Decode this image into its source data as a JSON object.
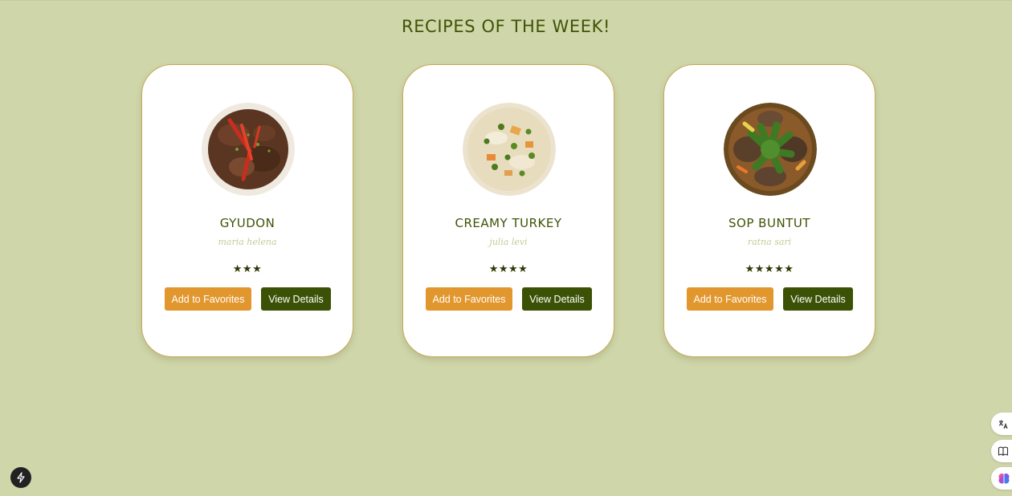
{
  "page": {
    "title": "RECIPES OF THE WEEK!"
  },
  "recipes": [
    {
      "name": "GYUDON",
      "author": "maria helena",
      "rating": 3,
      "stars": "★★★",
      "image": "gyudon-photo",
      "favorite_label": "Add to Favorites",
      "details_label": "View Details"
    },
    {
      "name": "CREAMY TURKEY",
      "author": "julia levi",
      "rating": 4,
      "stars": "★★★★",
      "image": "creamy-turkey-photo",
      "favorite_label": "Add to Favorites",
      "details_label": "View Details"
    },
    {
      "name": "SOP BUNTUT",
      "author": "ratna sari",
      "rating": 5,
      "stars": "★★★★★",
      "image": "sop-buntut-photo",
      "favorite_label": "Add to Favorites",
      "details_label": "View Details"
    }
  ],
  "overlay": {
    "bottom_left_icon": "lightning-icon",
    "side_icons": [
      "translate-icon",
      "book-icon",
      "brain-icon"
    ]
  },
  "colors": {
    "background": "#cfd6a9",
    "accent_green": "#3b5206",
    "accent_orange": "#e2972e",
    "card_border": "#c9a957"
  }
}
